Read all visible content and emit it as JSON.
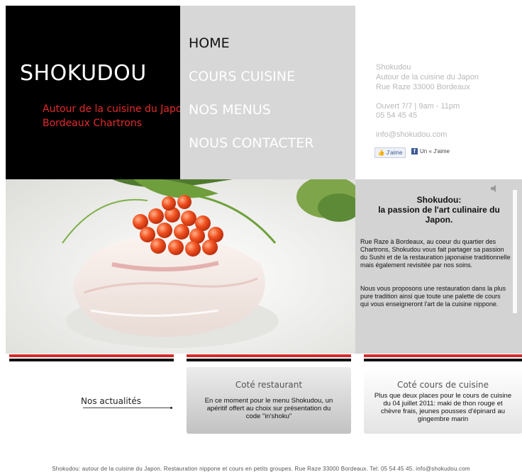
{
  "brand": {
    "name": "SHOKUDOU",
    "tagline_1": "Autour de la cuisine du Japon",
    "tagline_2": "Bordeaux Chartrons"
  },
  "nav": {
    "items": [
      {
        "label": "HOME",
        "active": true
      },
      {
        "label": "COURS CUISINE",
        "active": false
      },
      {
        "label": "NOS MENUS",
        "active": false
      },
      {
        "label": "NOUS CONTACTER",
        "active": false
      }
    ]
  },
  "contact": {
    "name": "Shokudou",
    "subtitle": "Autour de la cuisine  du Japon",
    "address": "Rue Raze 33000 Bordeaux",
    "hours": "Ouvert 7/7 |  9am - 11pm",
    "phone": "05 54 45 45",
    "email": "info@shokudou.com"
  },
  "social": {
    "like_label": "J'aime",
    "share_label": "Un « J'aime"
  },
  "about": {
    "title": "Shokudou:\nla passion de l'art culinaire du Japon.",
    "paragraph_1": "Rue Raze à Bordeaux, au coeur du quartier des Chartrons, Shokudou vous fait partager sa passion du Sushi et de la restauration japonaise traditionnelle mais également revisitée par nos soins.",
    "paragraph_2": "Nous vous proposons une restauration dans la plus pure tradition ainsi que  toute une palette de cours qui vous enseigneront l'art de la cuisine nippone."
  },
  "news": {
    "label": "Nos actualités"
  },
  "cards": {
    "restaurant": {
      "title": "Coté restaurant",
      "body": "En ce moment pour le menu Shokudou, un apéritif offert au choix sur présentation du code \"in'shoku\""
    },
    "cours": {
      "title": "Coté cours de cuisine",
      "body": "Plus que deux places pour le cours de cuisine du 04 juillet 2011: maki de thon rouge et chèvre frais, jeunes pousses d'épinard au gingembre marin"
    }
  },
  "footer": {
    "text": "Shokudou: autour de la cuisine du Japon. Restauration nippone et cours en petits groupes. Rue Raze 33000 Bordeaux. Tel: 05 54 45 45. info@shokudou.com"
  },
  "colors": {
    "brand_red": "#e52a2a",
    "nav_bg": "#d7d7d7",
    "about_bg": "#d3d3d3",
    "header_black": "#000000"
  }
}
